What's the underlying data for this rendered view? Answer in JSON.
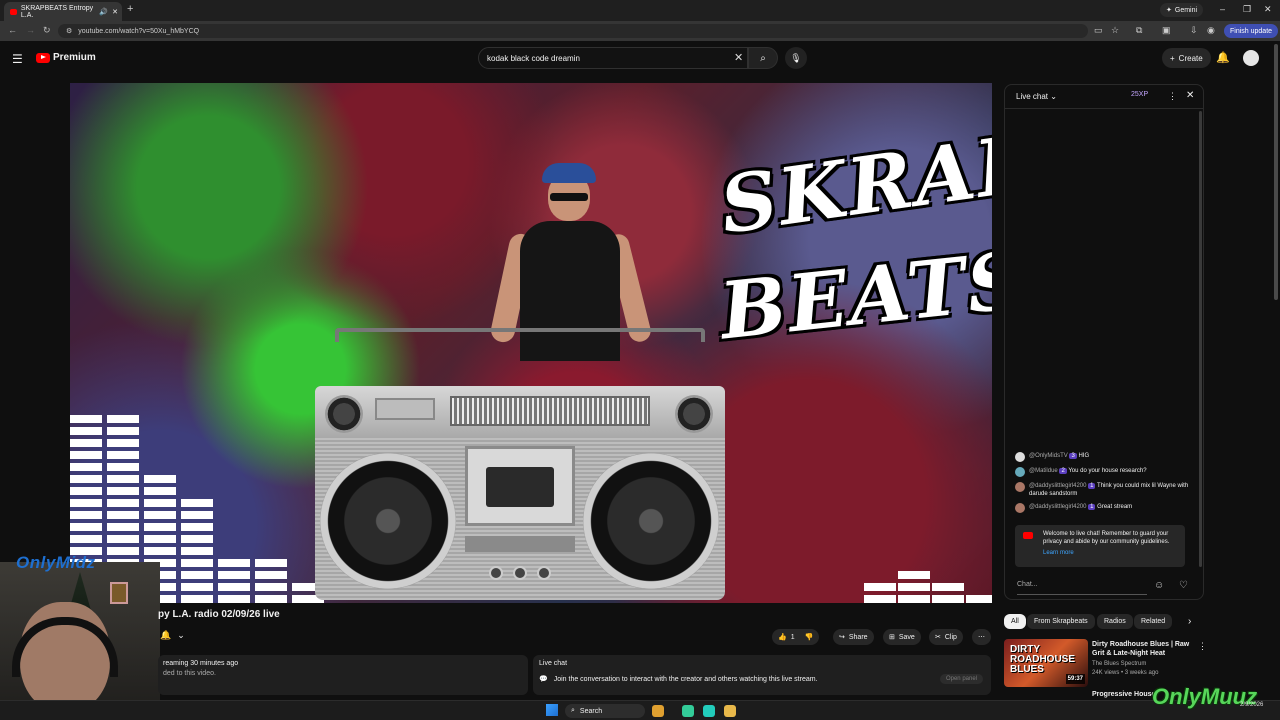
{
  "browser": {
    "tab_title": "SKRAPBEATS Entropy L.A.",
    "new_tab": "+",
    "gemini_label": "Gemini",
    "url": "youtube.com/watch?v=50Xu_hMbYCQ",
    "finish_update": "Finish update",
    "window_controls": [
      "–",
      "❐",
      "✕"
    ]
  },
  "header": {
    "logo_text": "Premium",
    "search_value": "kodak black code dreamin",
    "create_label": "Create"
  },
  "video": {
    "logo_line1": "SKRAP",
    "logo_line2": "BEATS",
    "overlay_brand": "OnlyMidz"
  },
  "below_video": {
    "title": "py L.A. radio 02/09/26 live",
    "actions": {
      "like_count": "1",
      "share": "Share",
      "save": "Save",
      "clip": "Clip"
    },
    "description": {
      "line1": "reaming 30 minutes ago",
      "line2": "ded to this video."
    },
    "live_chat_box": {
      "title": "Live chat",
      "text": "Join the conversation to interact with the creator and others watching this live stream.",
      "button": "Open panel"
    }
  },
  "chat": {
    "title": "Live chat",
    "xp_badge": "25XP",
    "messages": [
      {
        "user": "@OnlyMidsTV",
        "badge": "3",
        "text": "HIG"
      },
      {
        "user": "@Matildue",
        "badge": "2",
        "text": "You do your house research?"
      },
      {
        "user": "@daddyslittlegirl4200",
        "badge": "1",
        "text": "Think you could mix lil Wayne with darude sandstorm"
      },
      {
        "user": "@daddyslittlegirl4200",
        "badge": "1",
        "text": "Great stream"
      }
    ],
    "welcome_text": "Welcome to live chat! Remember to guard your privacy and abide by our community guidelines.",
    "learn_more": "Learn more",
    "input_placeholder": "Chat..."
  },
  "chips": [
    "All",
    "From Skrapbeats",
    "Radios",
    "Related"
  ],
  "recommendation": {
    "thumb_text": "DIRTY ROADHOUSE BLUES",
    "duration": "59:37",
    "title": "Dirty Roadhouse Blues | Raw Grit & Late-Night Heat",
    "channel": "The Blues Spectrum",
    "meta": "24K views • 3 weeks ago",
    "next_title": "Progressive House"
  },
  "taskbar": {
    "search": "Search",
    "watermark": "OnlyMuuz",
    "date": "2/9/2026"
  },
  "colors": {
    "background": "#0f0f0f",
    "yt_red": "#ff0000",
    "accent_blue": "#3ea6ff",
    "member_badge": "#5b3fbf"
  }
}
